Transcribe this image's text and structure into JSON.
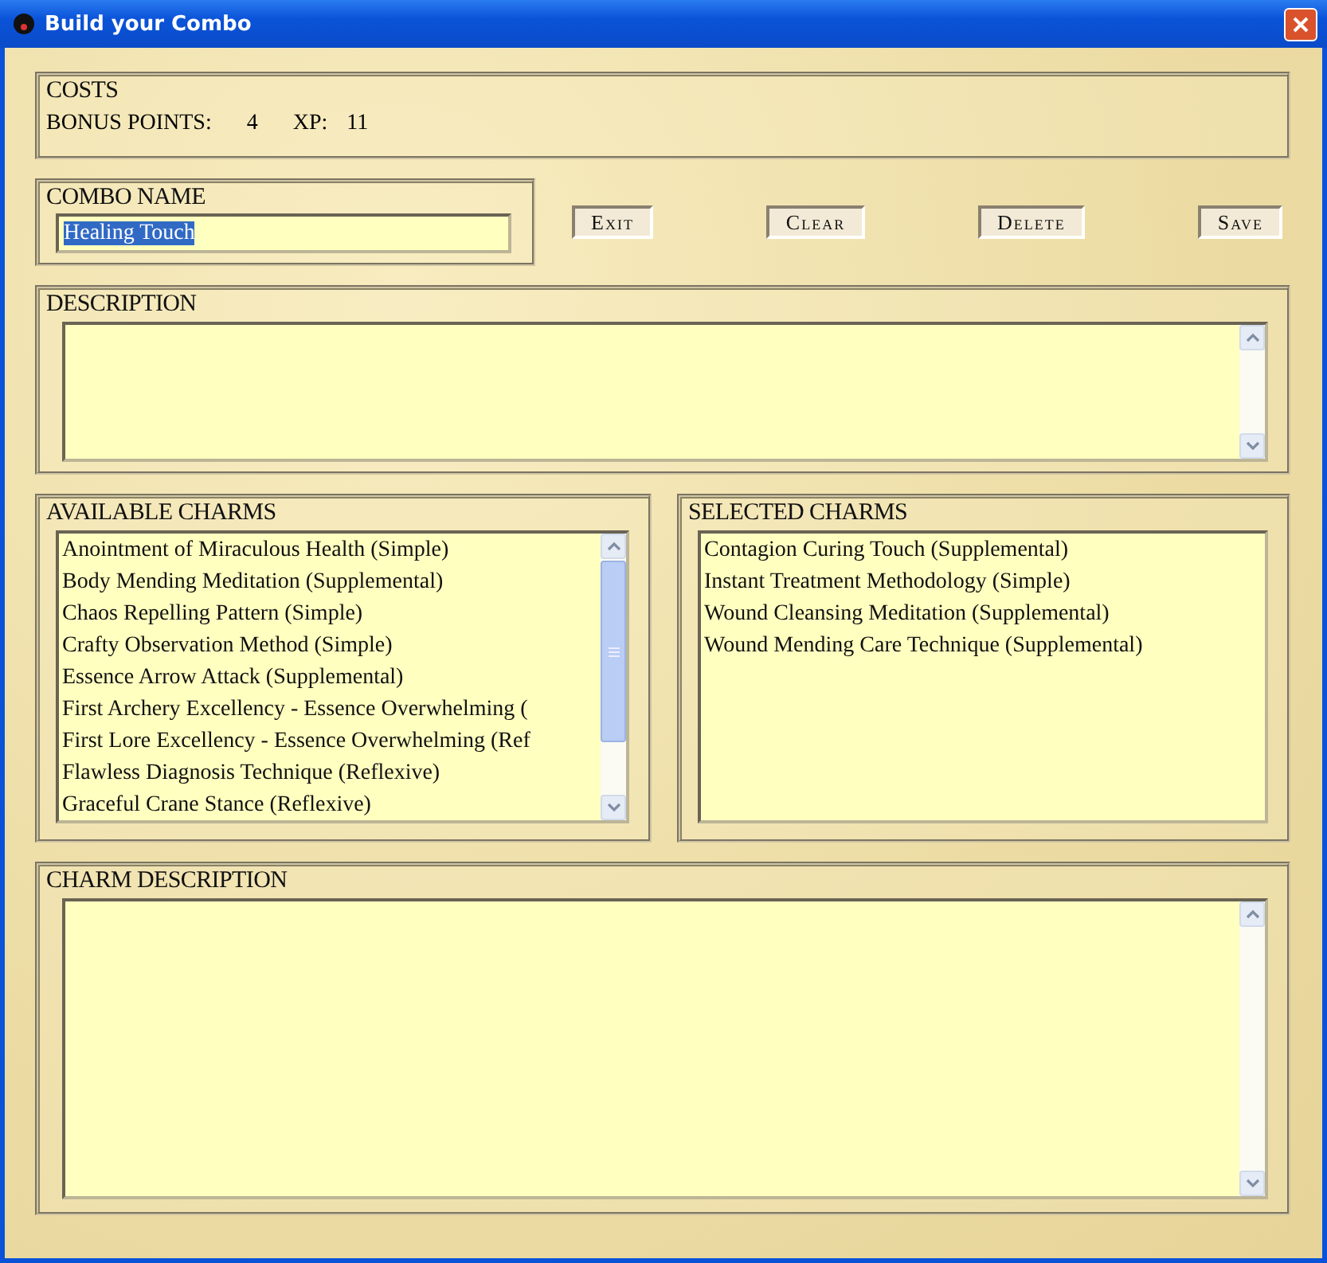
{
  "window": {
    "title": "Build your Combo"
  },
  "costs": {
    "title": "COSTS",
    "bonus_label": "BONUS POINTS:",
    "bonus_value": "4",
    "xp_label": "XP:",
    "xp_value": "11"
  },
  "combo_name": {
    "title": "COMBO NAME",
    "value": "Healing Touch"
  },
  "buttons": [
    "Exit",
    "Clear",
    "Delete",
    "Save"
  ],
  "description": {
    "title": "DESCRIPTION"
  },
  "available_charms": {
    "title": "AVAILABLE CHARMS",
    "items": [
      "Anointment of Miraculous Health (Simple)",
      "Body Mending Meditation (Supplemental)",
      "Chaos Repelling Pattern (Simple)",
      "Crafty Observation Method (Simple)",
      "Essence Arrow Attack (Supplemental)",
      "First Archery Excellency - Essence Overwhelming (",
      "First Lore Excellency - Essence Overwhelming (Ref",
      "Flawless Diagnosis Technique (Reflexive)",
      "Graceful Crane Stance (Reflexive)"
    ]
  },
  "selected_charms": {
    "title": "SELECTED CHARMS",
    "items": [
      "Contagion Curing Touch (Supplemental)",
      "Instant Treatment Methodology (Simple)",
      "Wound Cleansing Meditation (Supplemental)",
      "Wound Mending Care Technique (Supplemental)"
    ]
  },
  "charm_description": {
    "title": "CHARM DESCRIPTION"
  }
}
